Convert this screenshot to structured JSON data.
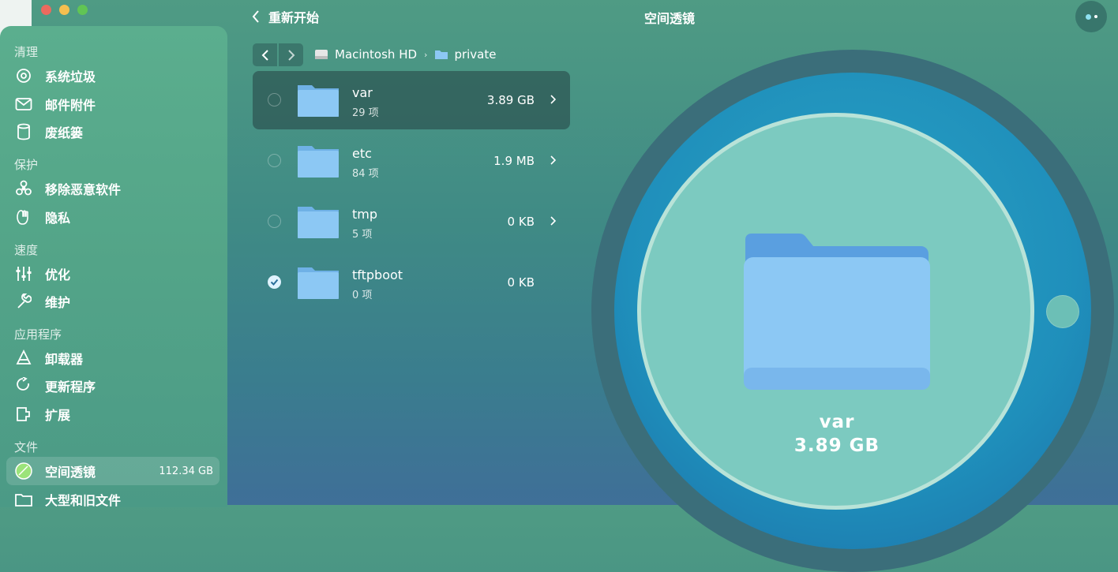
{
  "window": {
    "title": "空间透镜",
    "back_label": "重新开始"
  },
  "sidebar": {
    "sections": [
      {
        "title": "清理",
        "items": [
          {
            "label": "系统垃圾",
            "icon": "trash-disc-icon"
          },
          {
            "label": "邮件附件",
            "icon": "mail-icon"
          },
          {
            "label": "废纸篓",
            "icon": "trash-can-icon"
          }
        ]
      },
      {
        "title": "保护",
        "items": [
          {
            "label": "移除恶意软件",
            "icon": "biohazard-icon"
          },
          {
            "label": "隐私",
            "icon": "hand-icon"
          }
        ]
      },
      {
        "title": "速度",
        "items": [
          {
            "label": "优化",
            "icon": "sliders-icon"
          },
          {
            "label": "维护",
            "icon": "wrench-icon"
          }
        ]
      },
      {
        "title": "应用程序",
        "items": [
          {
            "label": "卸载器",
            "icon": "apps-icon"
          },
          {
            "label": "更新程序",
            "icon": "update-icon"
          },
          {
            "label": "扩展",
            "icon": "extension-icon"
          }
        ]
      },
      {
        "title": "文件",
        "items": [
          {
            "label": "空间透镜",
            "icon": "space-lens-icon",
            "size": "112.34 GB"
          },
          {
            "label": "大型和旧文件",
            "icon": "folder-icon"
          }
        ]
      }
    ]
  },
  "breadcrumb": {
    "drive": "Macintosh HD",
    "folder": "private"
  },
  "files": [
    {
      "name": "var",
      "count": "29 项",
      "size": "3.89 GB",
      "checked": false,
      "selected": true,
      "expandable": true
    },
    {
      "name": "etc",
      "count": "84 项",
      "size": "1.9 MB",
      "checked": false,
      "selected": false,
      "expandable": true
    },
    {
      "name": "tmp",
      "count": "5 项",
      "size": "0 KB",
      "checked": false,
      "selected": false,
      "expandable": true
    },
    {
      "name": "tftpboot",
      "count": "0 项",
      "size": "0 KB",
      "checked": true,
      "selected": false,
      "expandable": false
    }
  ],
  "preview": {
    "name": "var",
    "size": "3.89 GB"
  },
  "colors": {
    "folder_blue": "#8cc8f4",
    "accent_blue": "#1f8fbb",
    "sidebar_green": "#53a488"
  }
}
